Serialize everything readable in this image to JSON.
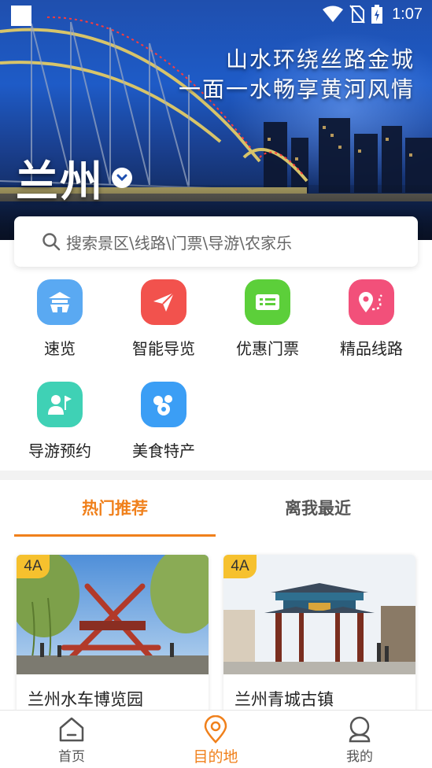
{
  "status_bar": {
    "time": "1:07"
  },
  "hero": {
    "slogan_line1": "山水环绕丝路金城",
    "slogan_line2": "一面一水畅享黄河风情",
    "city": "兰州"
  },
  "search": {
    "placeholder": "搜索景区\\线路\\门票\\导游\\农家乐"
  },
  "categories": [
    {
      "label": "速览",
      "icon": "pavilion-icon",
      "color": "#5aa9f2"
    },
    {
      "label": "智能导览",
      "icon": "paper-plane-icon",
      "color": "#f2524d"
    },
    {
      "label": "优惠门票",
      "icon": "ticket-icon",
      "color": "#5ccf3a"
    },
    {
      "label": "精品线路",
      "icon": "route-pin-icon",
      "color": "#f2507a"
    },
    {
      "label": "导游预约",
      "icon": "guide-flag-icon",
      "color": "#3fd1b5"
    },
    {
      "label": "美食特产",
      "icon": "food-icon",
      "color": "#3b9ef5"
    }
  ],
  "tabs": {
    "hot": "热门推荐",
    "near": "离我最近"
  },
  "cards": [
    {
      "badge": "4A",
      "title": "兰州水车博览园"
    },
    {
      "badge": "4A",
      "title": "兰州青城古镇"
    }
  ],
  "nav": {
    "home": "首页",
    "destination": "目的地",
    "mine": "我的"
  },
  "colors": {
    "accent": "#f0801b",
    "badge": "#f6c12e"
  }
}
